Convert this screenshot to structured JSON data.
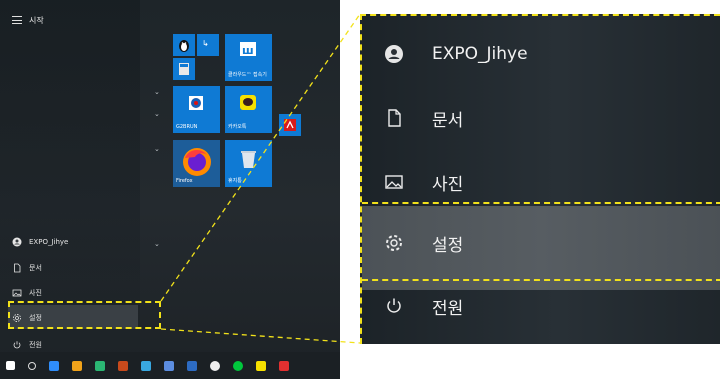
{
  "start_menu": {
    "header_title": "시작",
    "nav_items": [
      {
        "label": "EXPO_Jihye",
        "icon": "user-icon"
      },
      {
        "label": "문서",
        "icon": "document-icon"
      },
      {
        "label": "사진",
        "icon": "pictures-icon"
      },
      {
        "label": "설정",
        "icon": "gear-icon"
      },
      {
        "label": "전원",
        "icon": "power-icon"
      }
    ],
    "tiles": [
      {
        "label": "클라우드™ 접속기"
      },
      {
        "label": "G2BRUN"
      },
      {
        "label": "카카오톡"
      },
      {
        "label": "Firefox"
      },
      {
        "label": "휴지통"
      }
    ]
  },
  "zoom_menu": {
    "items": [
      {
        "label": "EXPO_Jihye",
        "icon": "user-icon"
      },
      {
        "label": "문서",
        "icon": "document-icon"
      },
      {
        "label": "사진",
        "icon": "pictures-icon"
      },
      {
        "label": "설정",
        "icon": "gear-icon"
      },
      {
        "label": "전원",
        "icon": "power-icon"
      }
    ]
  },
  "colors": {
    "highlight": "#f2e21a",
    "tile": "#0f7ad4",
    "menu_bg": "#242a2f"
  }
}
